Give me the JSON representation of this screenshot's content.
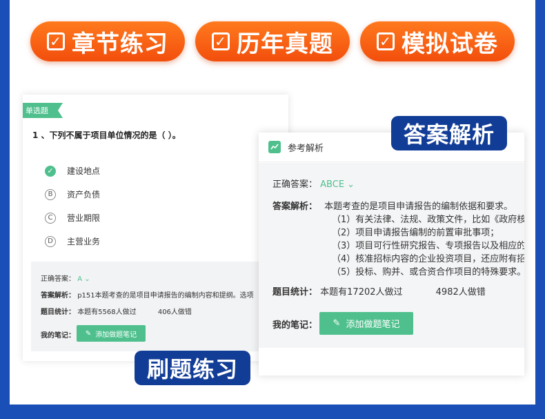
{
  "banners": [
    {
      "label": "章节练习"
    },
    {
      "label": "历年真题"
    },
    {
      "label": "模拟试卷"
    }
  ],
  "left_card": {
    "tag": "单选题",
    "question": "1 、下列不属于项目单位情况的是（ ）。",
    "options": [
      {
        "letter": "✓",
        "text": "建设地点"
      },
      {
        "letter": "B",
        "text": "资产负债"
      },
      {
        "letter": "C",
        "text": "营业期限"
      },
      {
        "letter": "D",
        "text": "主营业务"
      }
    ],
    "answer_label": "正确答案：",
    "answer_value": "A",
    "analysis_label": "答案解析：",
    "analysis_text": "p151本题考查的是项目申请报告的编制内容和提纲。选项",
    "stats_label": "题目统计：",
    "stats_done": "本题有5568人做过",
    "stats_wrong": "406人做错",
    "note_label": "我的笔记：",
    "note_button": "添加做题笔记"
  },
  "right_card": {
    "title": "参考解析",
    "answer_label": "正确答案：",
    "answer_value": "ABCE",
    "analysis_label": "答案解析：",
    "analysis_intro": "本题考查的是项目申请报告的编制依据和要求。",
    "analysis_items": [
      "（1）有关法律、法规、政策文件，比如《政府核",
      "（2）项目申请报告编制的前置审批事项；",
      "（3）项目可行性研究报告、专项报告以及相应的",
      "（4）核准招标内容的企业投资项目，还应附有招",
      "（5）投标、购并、或合资合作项目的特殊要求。"
    ],
    "stats_label": "题目统计：",
    "stats_done": "本题有17202人做过",
    "stats_wrong": "4982人做错",
    "note_label": "我的笔记：",
    "note_button": "添加做题笔记"
  },
  "labels": {
    "answer_analysis": "答案解析",
    "practice": "刷题练习"
  },
  "colors": {
    "accent_green": "#4fc08d",
    "banner_orange": "#f24e0c",
    "label_blue": "#123d97",
    "background_blue": "#1a4fb8"
  }
}
